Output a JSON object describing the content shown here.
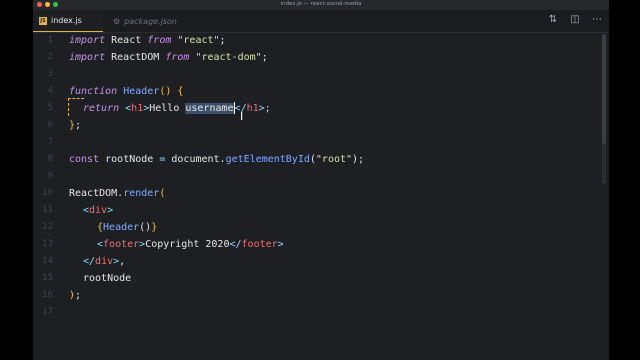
{
  "window": {
    "title": "index.js — react-social-media"
  },
  "tabs": [
    {
      "label": "index.js",
      "close": "×",
      "active": true
    },
    {
      "label": "package.json",
      "active": false
    }
  ],
  "icons": {
    "tab_js": "js-file-icon",
    "tab_json": "json-file-icon",
    "source_control": "source-control-icon",
    "split": "split-editor-icon",
    "more": "more-icon"
  },
  "editor": {
    "line_numbers": [
      "1",
      "2",
      "3",
      "4",
      "5",
      "6",
      "7",
      "8",
      "9",
      "10",
      "11",
      "12",
      "13",
      "14",
      "15",
      "16",
      "17"
    ],
    "selection": "username"
  },
  "code": {
    "l1": {
      "import": "import",
      "name": " React ",
      "from": "from",
      "src": " \"react\"",
      "end": ";"
    },
    "l2": {
      "import": "import",
      "name": " ReactDOM ",
      "from": "from",
      "src": " \"react-dom\"",
      "end": ";"
    },
    "l4": {
      "kw": "function",
      "name": " Header",
      "paren": "()",
      "brace": " {"
    },
    "l5": {
      "kw": "return",
      "open": " <",
      "tag": "h1",
      "gt": ">",
      "text1": "Hello ",
      "sel": "username",
      "close": "</",
      "tag2": "h1",
      "gt2": ">;",
      "rest": ""
    },
    "l6": {
      "brace": "}",
      "end": ";"
    },
    "l8": {
      "kw": "const",
      "name": " rootNode ",
      "eq": "=",
      "obj": " document.",
      "fn": "getElementById",
      "arg_open": "(",
      "arg": "\"root\"",
      "arg_close": ");"
    },
    "l10": {
      "obj": "ReactDOM.",
      "fn": "render",
      "open": "("
    },
    "l11": {
      "lt": "<",
      "tag": "div",
      "gt": ">"
    },
    "l12": {
      "ob": "{",
      "comp": "Header",
      "paren": "()",
      "cb": "}"
    },
    "l13": {
      "lt": "<",
      "tag": "footer",
      "gt": ">",
      "text": "Copyright 2020",
      "close": "</",
      "tag2": "footer",
      "gt2": ">"
    },
    "l14": {
      "close": "</",
      "tag": "div",
      "gt": ">",
      "end": ","
    },
    "l15": {
      "name": "rootNode"
    },
    "l16": {
      "close": ")",
      "end": ";"
    }
  }
}
